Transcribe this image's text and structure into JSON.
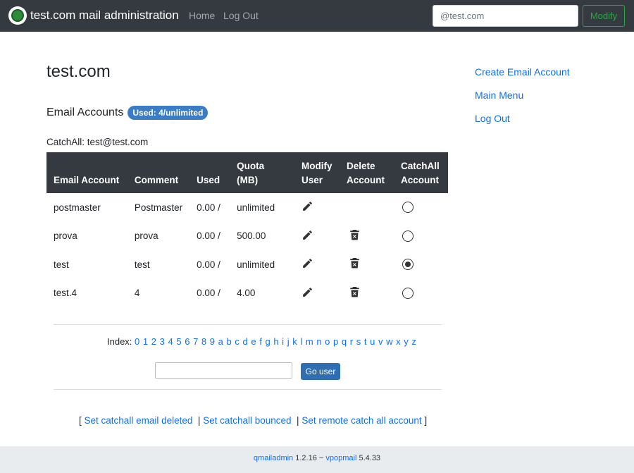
{
  "navbar": {
    "brand": "test.com mail administration",
    "home": "Home",
    "logout": "Log Out",
    "search_placeholder": "@test.com",
    "modify_button": "Modify"
  },
  "domain_title": "test.com",
  "accounts_heading": "Email Accounts",
  "badge": "Used: 4/unlimited",
  "catchall_line": "CatchAll: test@test.com",
  "table": {
    "headers": {
      "email": "Email Account",
      "comment": "Comment",
      "used": "Used",
      "quota": "Quota (MB)",
      "modify_1": "Modify",
      "modify_2": "User",
      "delete_1": "Delete",
      "delete_2": "Account",
      "catchall_1": "CatchAll",
      "catchall_2": "Account"
    },
    "rows": [
      {
        "email": "postmaster",
        "comment": "Postmaster",
        "used": "0.00 /",
        "quota": "unlimited",
        "deletable": false,
        "catchall": false
      },
      {
        "email": "prova",
        "comment": "prova",
        "used": "0.00 /",
        "quota": "500.00",
        "deletable": true,
        "catchall": false
      },
      {
        "email": "test",
        "comment": "test",
        "used": "0.00 /",
        "quota": "unlimited",
        "deletable": true,
        "catchall": true
      },
      {
        "email": "test.4",
        "comment": "4",
        "used": "0.00 /",
        "quota": "4.00",
        "deletable": true,
        "catchall": false
      }
    ]
  },
  "index": {
    "label": "Index:",
    "chars": "0 1 2 3 4 5 6 7 8 9 a b c d e f g h i j k l m n o p q r s t u v w x y z"
  },
  "go_user_button": "Go user",
  "catch_links": {
    "open": "[",
    "deleted": "Set catchall email deleted",
    "sep1": "|",
    "bounced": "Set catchall bounced",
    "sep2": "|",
    "remote": "Set remote catch all account",
    "close": "]"
  },
  "sidebar": {
    "create": "Create Email Account",
    "main_menu": "Main Menu",
    "logout": "Log Out"
  },
  "footer": {
    "app": "qmailadmin",
    "app_version": "1.2.16 ~",
    "backend": "vpopmail",
    "backend_version": "5.4.33"
  },
  "colors": {
    "navbar": "#343a40",
    "link": "#0d6efd",
    "badge": "#3a7dc6",
    "modify_button": "#28a745"
  }
}
